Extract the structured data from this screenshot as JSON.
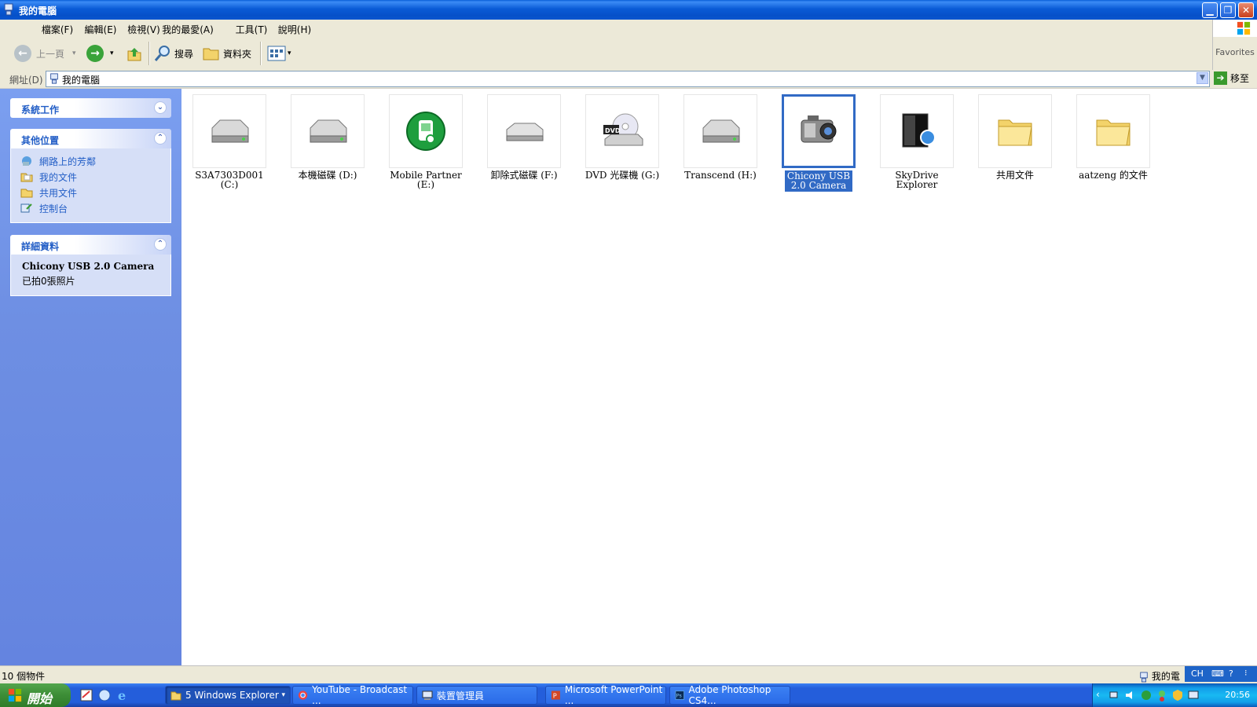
{
  "window": {
    "title": "我的電腦"
  },
  "menu": [
    "檔案(F)",
    "編輯(E)",
    "檢視(V)",
    "我的最愛(A)",
    "工具(T)",
    "說明(H)"
  ],
  "toolbar": {
    "back": "上一頁",
    "search": "搜尋",
    "folders": "資料夾",
    "favorites": "Favorites"
  },
  "address": {
    "label": "網址(D)",
    "value": "我的電腦",
    "go": "移至"
  },
  "left": {
    "system_tasks": {
      "title": "系統工作"
    },
    "other_places": {
      "title": "其他位置",
      "links": [
        "網路上的芳鄰",
        "我的文件",
        "共用文件",
        "控制台"
      ]
    },
    "details": {
      "title": "詳細資料",
      "name": "Chicony USB 2.0 Camera",
      "info": "已拍0張照片"
    }
  },
  "items": [
    {
      "label": "S3A7303D001 (C:)",
      "icon": "hard-drive"
    },
    {
      "label": "本機磁碟 (D:)",
      "icon": "hard-drive"
    },
    {
      "label": "Mobile Partner (E:)",
      "icon": "mobile-partner"
    },
    {
      "label": "卸除式磁碟 (F:)",
      "icon": "removable-drive"
    },
    {
      "label": "DVD 光碟機 (G:)",
      "icon": "dvd-drive"
    },
    {
      "label": "Transcend (H:)",
      "icon": "hard-drive"
    },
    {
      "label": "Chicony USB 2.0 Camera",
      "icon": "camera",
      "selected": true
    },
    {
      "label": "SkyDrive Explorer",
      "icon": "skydrive"
    },
    {
      "label": "共用文件",
      "icon": "folder"
    },
    {
      "label": "aatzeng 的文件",
      "icon": "folder"
    }
  ],
  "status": {
    "count": "10 個物件",
    "location": "我的電"
  },
  "taskbar": {
    "start": "開始",
    "tasks": [
      "5 Windows Explorer",
      "YouTube - Broadcast ...",
      "裝置管理員",
      "Microsoft PowerPoint ...",
      "Adobe Photoshop CS4..."
    ],
    "lang": "CH",
    "clock": "20:56"
  },
  "colors": {
    "title_blue": "#0a5fd8",
    "selection": "#316ac5",
    "task_pane": "#6e8fe3",
    "start_green": "#3c8d36"
  }
}
